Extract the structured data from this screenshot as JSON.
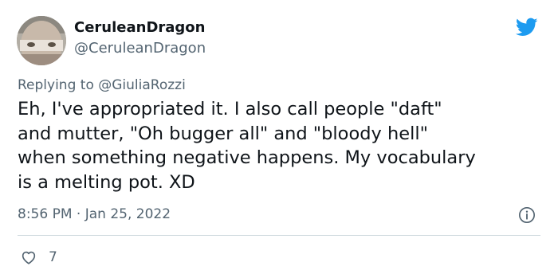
{
  "user": {
    "display_name": "CeruleanDragon",
    "handle": "@CeruleanDragon"
  },
  "reply": {
    "prefix": "Replying to ",
    "mention": "@GiuliaRozzi"
  },
  "tweet": {
    "lines": [
      "Eh, I've appropriated it. I also call people \"daft\"",
      "and mutter, \"Oh bugger all\" and \"bloody hell\"",
      "when something negative happens. My vocabulary",
      "is a melting pot. XD"
    ],
    "time": "8:56 PM",
    "separator": " · ",
    "date": "Jan 25, 2022",
    "likes": "7"
  },
  "icons": {
    "brand": "twitter-bird-icon",
    "info": "info-icon",
    "like": "heart-icon"
  },
  "colors": {
    "twitter_blue": "#1d9bf0",
    "text_primary": "#0f1419",
    "text_secondary": "#536471",
    "divider": "#cfd9de"
  }
}
